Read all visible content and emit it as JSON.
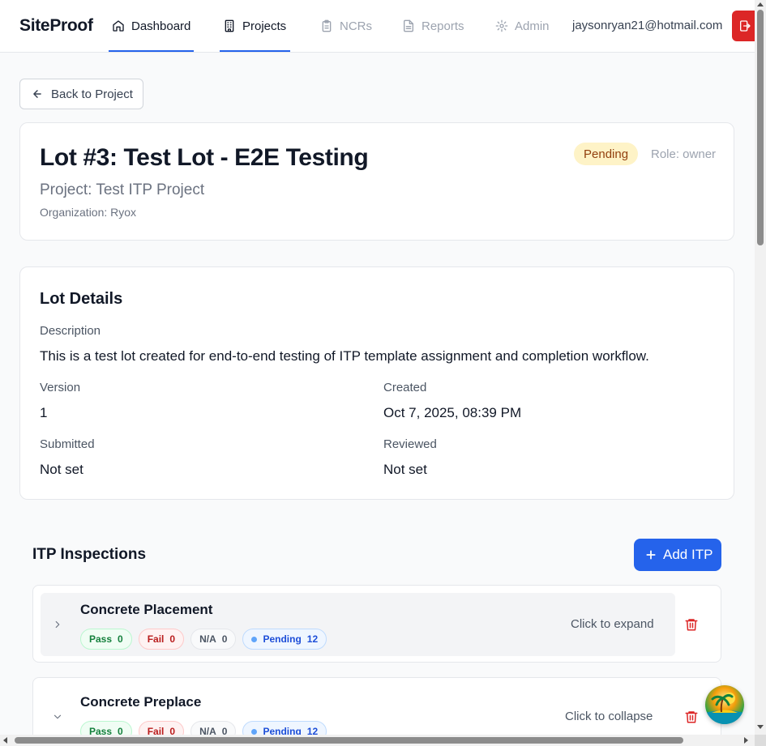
{
  "nav": {
    "brand": "SiteProof",
    "items": [
      {
        "label": "Dashboard",
        "icon": "home-icon",
        "active": true
      },
      {
        "label": "Projects",
        "icon": "building-icon",
        "active": true
      },
      {
        "label": "NCRs",
        "icon": "clipboard-icon",
        "active": false
      },
      {
        "label": "Reports",
        "icon": "file-icon",
        "active": false
      },
      {
        "label": "Admin",
        "icon": "gear-icon",
        "active": false
      }
    ],
    "user_email": "jaysonryan21@hotmail.com"
  },
  "back_button": {
    "label": "Back to Project"
  },
  "lot": {
    "title": "Lot #3: Test Lot - E2E Testing",
    "project": "Project: Test ITP Project",
    "organization": "Organization: Ryox",
    "status": "Pending",
    "role": "Role: owner"
  },
  "details": {
    "title": "Lot Details",
    "description_label": "Description",
    "description": "This is a test lot created for end-to-end testing of ITP template assignment and completion workflow.",
    "version_label": "Version",
    "version": "1",
    "created_label": "Created",
    "created": "Oct 7, 2025, 08:39 PM",
    "submitted_label": "Submitted",
    "submitted": "Not set",
    "reviewed_label": "Reviewed",
    "reviewed": "Not set"
  },
  "itp": {
    "title": "ITP Inspections",
    "add_label": "Add ITP",
    "items": [
      {
        "name": "Concrete Placement",
        "pass_label": "Pass",
        "pass": "0",
        "fail_label": "Fail",
        "fail": "0",
        "na_label": "N/A",
        "na": "0",
        "pending_label": "Pending",
        "pending": "12",
        "toggle_text": "Click to expand"
      },
      {
        "name": "Concrete Preplace",
        "pass_label": "Pass",
        "pass": "0",
        "fail_label": "Fail",
        "fail": "0",
        "na_label": "N/A",
        "na": "0",
        "pending_label": "Pending",
        "pending": "12",
        "toggle_text": "Click to collapse"
      }
    ]
  },
  "colors": {
    "accent": "#2563eb",
    "danger": "#dc2626",
    "pending_bg": "#fef3c7",
    "pending_text": "#92400e"
  }
}
